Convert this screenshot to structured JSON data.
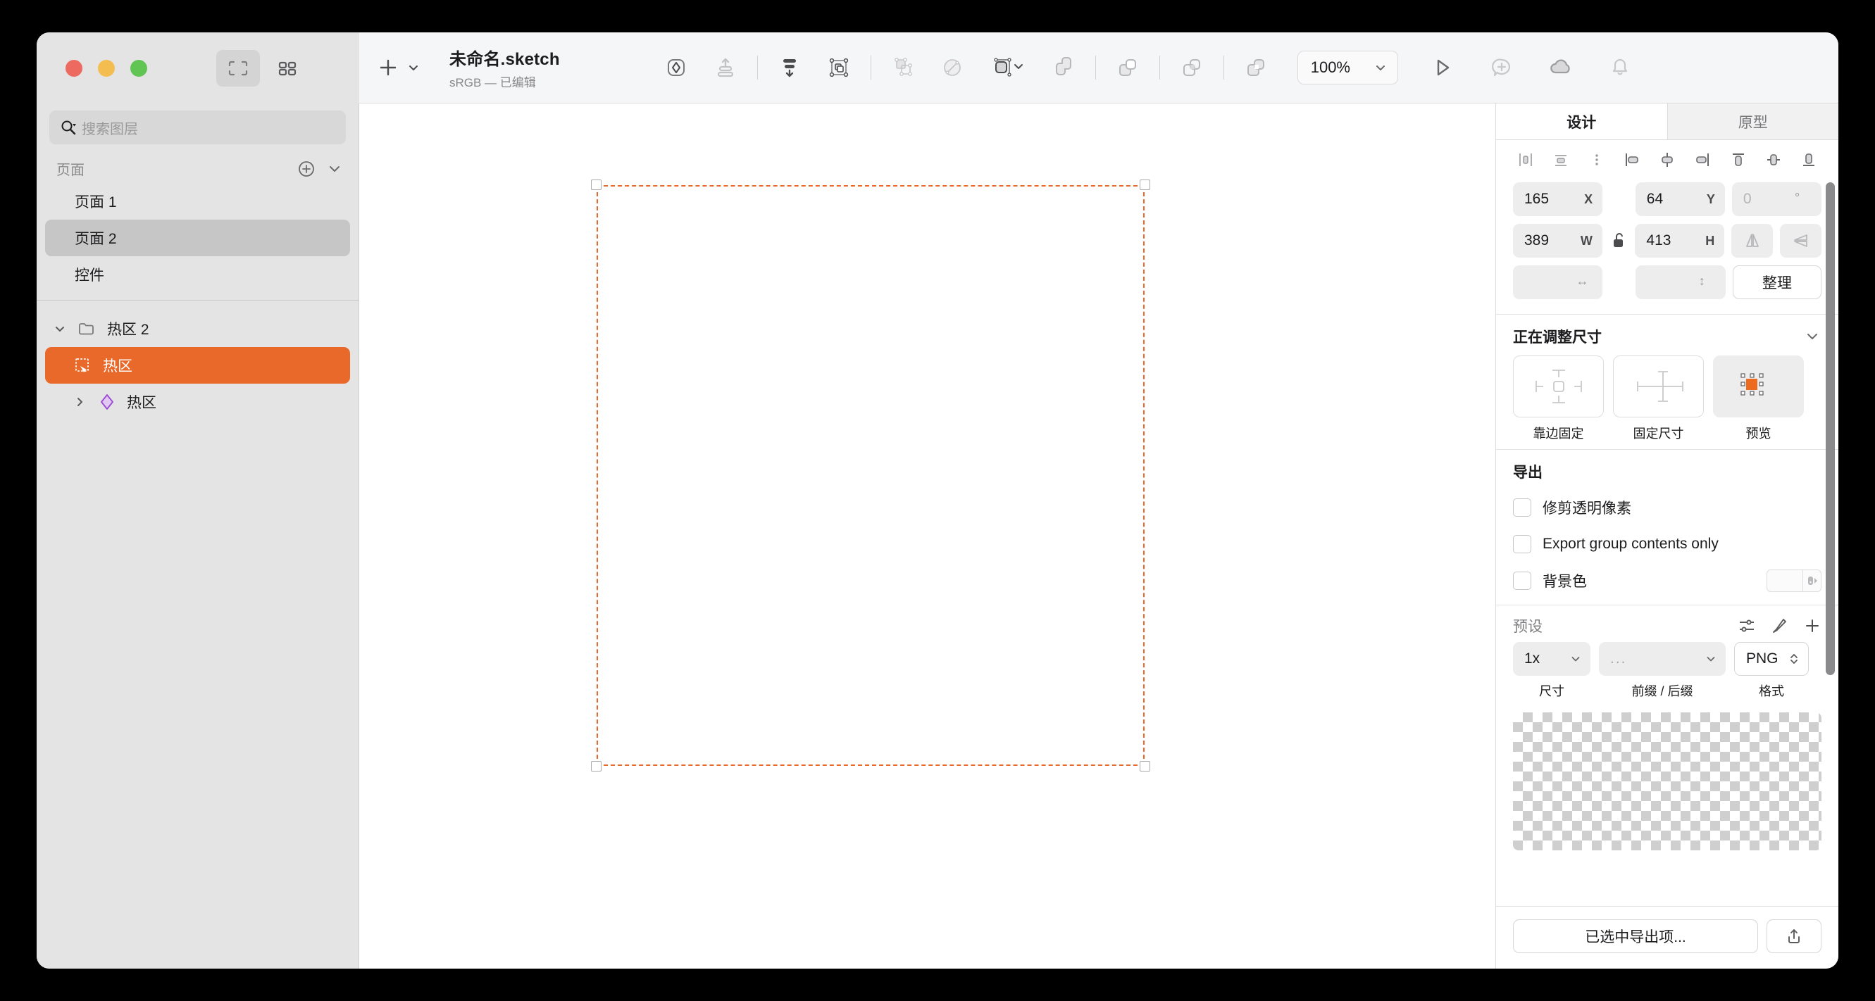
{
  "window": {
    "traffic_lights": [
      "close",
      "minimize",
      "maximize"
    ],
    "view_modes": [
      "canvas-view-icon",
      "grid-view-icon"
    ]
  },
  "toolbar": {
    "add_label": "+",
    "add_dropdown_icon": "chevron-down-icon",
    "document_title": "未命名.sketch",
    "document_subtitle": "sRGB — 已编辑",
    "tools": [
      {
        "name": "symbol-icon",
        "label": "创建元件"
      },
      {
        "name": "move-forward-icon",
        "label": "上移一层"
      },
      {
        "name": "move-backward-icon",
        "label": "下移一层"
      },
      {
        "name": "group-icon",
        "label": "编组"
      },
      {
        "name": "ungroup-icon",
        "label": "取消编组"
      },
      {
        "name": "mask-icon",
        "label": "蒙版"
      },
      {
        "name": "scale-icon",
        "label": "缩放"
      }
    ],
    "boolean_ops": [
      {
        "name": "union-icon",
        "label": "合并"
      },
      {
        "name": "subtract-icon",
        "label": "减去"
      },
      {
        "name": "intersect-icon",
        "label": "相交"
      },
      {
        "name": "difference-icon",
        "label": "差集"
      }
    ],
    "zoom_value": "100%",
    "zoom_dropdown_icon": "chevron-down-icon",
    "right_actions": [
      {
        "name": "play-icon",
        "label": "预览"
      },
      {
        "name": "comment-add-icon",
        "label": "添加评论"
      },
      {
        "name": "cloud-icon",
        "label": "云文档"
      },
      {
        "name": "bell-icon",
        "label": "通知"
      }
    ]
  },
  "sidebar": {
    "search": {
      "placeholder": "搜索图层",
      "value": "",
      "icon": "search-icon"
    },
    "pages": {
      "title": "页面",
      "add_icon": "plus-circle-icon",
      "collapse_icon": "chevron-down-icon",
      "items": [
        {
          "label": "页面 1",
          "selected": false
        },
        {
          "label": "页面 2",
          "selected": true
        },
        {
          "label": "控件",
          "selected": false
        }
      ]
    },
    "layers": [
      {
        "label": "热区 2",
        "icon": "folder-icon",
        "disclosure": "chevron-down-icon",
        "depth": 0,
        "selected": false
      },
      {
        "label": "热区",
        "icon": "hotspot-icon",
        "disclosure": "",
        "depth": 1,
        "selected": true
      },
      {
        "label": "热区",
        "icon": "symbol-diamond-icon",
        "disclosure": "chevron-right-icon",
        "depth": 1,
        "selected": false
      }
    ]
  },
  "canvas": {
    "selection": {
      "visible": true,
      "stroke_color": "#e8692a",
      "handles": 4
    }
  },
  "inspector": {
    "tabs": [
      {
        "label": "设计",
        "active": true
      },
      {
        "label": "原型",
        "active": false
      }
    ],
    "align_tools": [
      "align-left-icon",
      "align-center-horizontal-icon",
      "distribute-icon",
      "align-object-left-icon",
      "align-object-center-icon",
      "align-object-right-icon",
      "align-top-icon",
      "align-middle-icon",
      "align-bottom-icon"
    ],
    "geometry": {
      "x": {
        "value": "165",
        "unit": "X"
      },
      "y": {
        "value": "64",
        "unit": "Y"
      },
      "rotation": {
        "value": "0",
        "unit": "°"
      },
      "w": {
        "value": "389",
        "unit": "W"
      },
      "h": {
        "value": "413",
        "unit": "H"
      },
      "lock_icon": "unlock-icon",
      "flip_horizontal_icon": "flip-horizontal-icon",
      "flip_vertical_icon": "flip-vertical-icon",
      "radius_placeholder": "",
      "radius_unit_icon": "arrow-horizontal-icon",
      "radius2_unit_icon": "arrow-vertical-icon",
      "tidy_label": "整理"
    },
    "resizing": {
      "title": "正在调整尺寸",
      "collapse_icon": "chevron-down-icon",
      "options": [
        {
          "label": "靠边固定",
          "icon": "pin-edges-icon",
          "selected": false
        },
        {
          "label": "固定尺寸",
          "icon": "fix-size-icon",
          "selected": false
        },
        {
          "label": "预览",
          "icon": "resize-preview-icon",
          "selected": true
        }
      ]
    },
    "export": {
      "title": "导出",
      "checkboxes": [
        {
          "label": "修剪透明像素",
          "checked": false
        },
        {
          "label": "Export group contents only",
          "checked": false
        },
        {
          "label": "背景色",
          "checked": false,
          "has_color_well": true
        }
      ],
      "presets": {
        "title": "预设",
        "actions": [
          "sliders-icon",
          "slice-icon",
          "plus-icon"
        ],
        "size": {
          "value": "1x",
          "label": "尺寸"
        },
        "prefix_suffix": {
          "value": "...",
          "label": "前缀 / 后缀"
        },
        "format": {
          "value": "PNG",
          "label": "格式"
        }
      },
      "export_button": "已选中导出项...",
      "share_icon": "share-icon"
    }
  }
}
